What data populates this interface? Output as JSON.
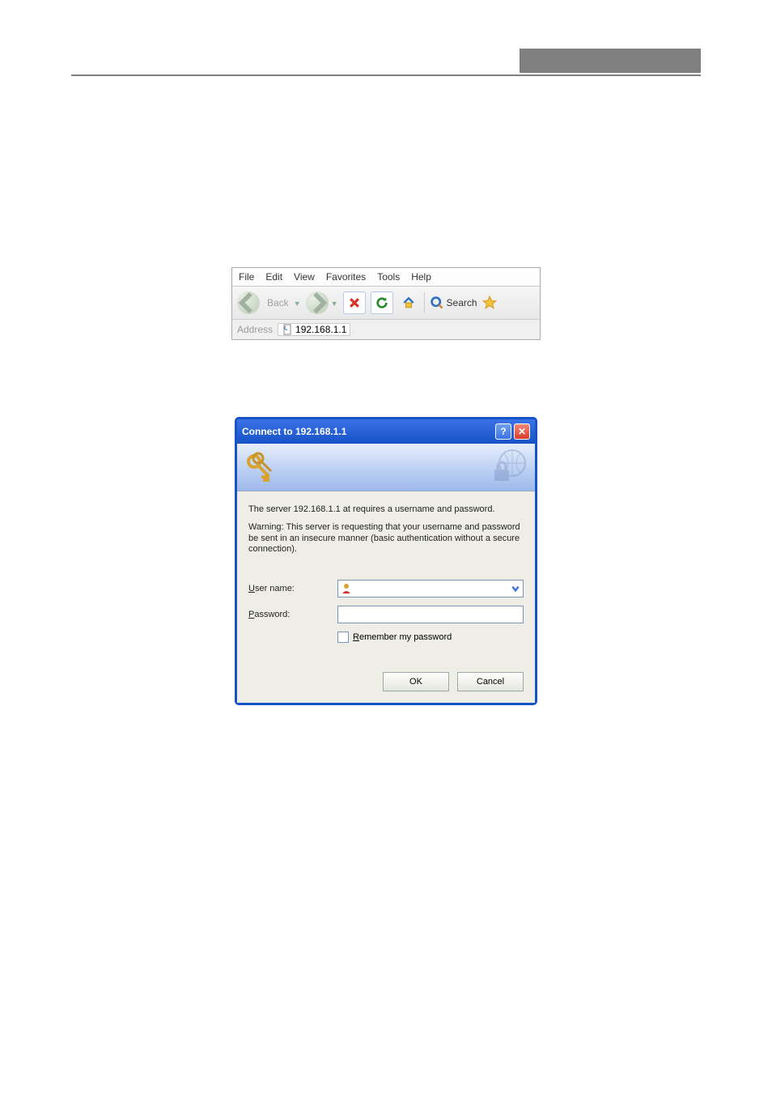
{
  "browser": {
    "menus": {
      "file": "File",
      "edit": "Edit",
      "view": "View",
      "favorites": "Favorites",
      "tools": "Tools",
      "help": "Help"
    },
    "toolbar": {
      "back": "Back",
      "search": "Search"
    },
    "address_label": "Address",
    "address_value": "192.168.1.1"
  },
  "auth": {
    "title": "Connect to 192.168.1.1",
    "line1": "The server 192.168.1.1 at  requires a username and password.",
    "line2": "Warning: This server is requesting that your username and password be sent in an insecure manner (basic authentication without a secure connection).",
    "username_label": "User name:",
    "password_label": "Password:",
    "remember_label": "Remember my password",
    "ok": "OK",
    "cancel": "Cancel"
  }
}
